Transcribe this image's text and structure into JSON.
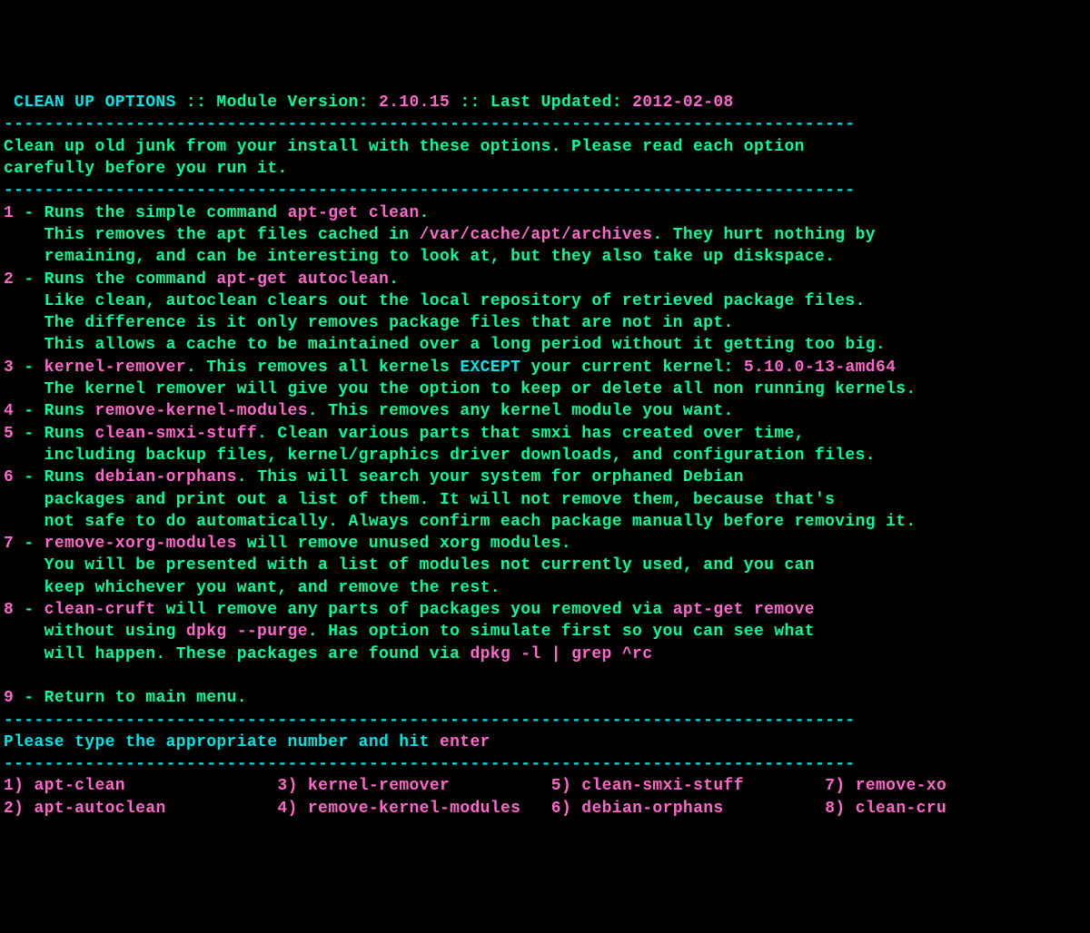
{
  "header": {
    "title": "CLEAN UP OPTIONS",
    "sep1": " :: ",
    "module_label": "Module Version: ",
    "module_version": "2.10.15",
    "sep2": " :: ",
    "updated_label": "Last Updated: ",
    "updated_date": "2012-02-08"
  },
  "divider": "------------------------------------------------------------------------------------",
  "intro": {
    "line1": "Clean up old junk from your install with these options. Please read each option",
    "line2": "carefully before you run it."
  },
  "options": {
    "o1": {
      "num": "1",
      "dash": " - ",
      "a": "Runs the simple command ",
      "cmd": "apt-get clean",
      "b": ".",
      "line2a": "    This removes the apt files cached in ",
      "line2b": "/var/cache/apt/archives",
      "line2c": ". They hurt nothing by",
      "line3": "    remaining, and can be interesting to look at, but they also take up diskspace."
    },
    "o2": {
      "num": "2",
      "dash": " - ",
      "a": "Runs the command ",
      "cmd": "apt-get autoclean",
      "b": ".",
      "line2": "    Like clean, autoclean clears out the local repository of retrieved package files.",
      "line3": "    The difference is it only removes package files that are not in apt.",
      "line4": "    This allows a cache to be maintained over a long period without it getting too big."
    },
    "o3": {
      "num": "3",
      "dash": " - ",
      "cmd": "kernel-remover",
      "a": ". This removes all kernels ",
      "except": "EXCEPT",
      "b": " your current kernel: ",
      "kernel": "5.10.0-13-amd64",
      "line2": "    The kernel remover will give you the option to keep or delete all non running kernels."
    },
    "o4": {
      "num": "4",
      "dash": " - ",
      "a": "Runs ",
      "cmd": "remove-kernel-modules",
      "b": ". This removes any kernel module you want."
    },
    "o5": {
      "num": "5",
      "dash": " - ",
      "a": "Runs ",
      "cmd": "clean-smxi-stuff",
      "b": ". Clean various parts that smxi has created over time,",
      "line2": "    including backup files, kernel/graphics driver downloads, and configuration files."
    },
    "o6": {
      "num": "6",
      "dash": " - ",
      "a": "Runs ",
      "cmd": "debian-orphans",
      "b": ". This will search your system for orphaned Debian",
      "line2": "    packages and print out a list of them. It will not remove them, because that's",
      "line3": "    not safe to do automatically. Always confirm each package manually before removing it."
    },
    "o7": {
      "num": "7",
      "dash": " - ",
      "cmd": "remove-xorg-modules",
      "a": " will remove unused xorg modules.",
      "line2": "    You will be presented with a list of modules not currently used, and you can",
      "line3": "    keep whichever you want, and remove the rest."
    },
    "o8": {
      "num": "8",
      "dash": " - ",
      "cmd": "clean-cruft",
      "a": " will remove any parts of packages you removed via ",
      "cmd2": "apt-get remove",
      "line2a": "    without using ",
      "cmd3": "dpkg --purge",
      "line2b": ". Has option to simulate first so you can see what",
      "line3a": "    will happen. These packages are found via ",
      "cmd4": "dpkg -l | grep ^rc"
    },
    "o9": {
      "num": "9",
      "dash": " - ",
      "a": "Return to main menu."
    }
  },
  "prompt": {
    "a": "Please type the appropriate number and hit ",
    "enter": "enter"
  },
  "menu": {
    "i1": {
      "p": "1) ",
      "label": "apt-clean"
    },
    "i2": {
      "p": "2) ",
      "label": "apt-autoclean"
    },
    "i3": {
      "p": "3) ",
      "label": "kernel-remover"
    },
    "i4": {
      "p": "4) ",
      "label": "remove-kernel-modules"
    },
    "i5": {
      "p": "5) ",
      "label": "clean-smxi-stuff"
    },
    "i6": {
      "p": "6) ",
      "label": "debian-orphans"
    },
    "i7": {
      "p": "7) ",
      "label": "remove-xo"
    },
    "i8": {
      "p": "8) ",
      "label": "clean-cru"
    }
  },
  "pad": {
    "col1": "               ",
    "col1b": "           ",
    "col2": "          ",
    "col2b": "   ",
    "col3": "        ",
    "col3b": "          ",
    "gap": " "
  }
}
